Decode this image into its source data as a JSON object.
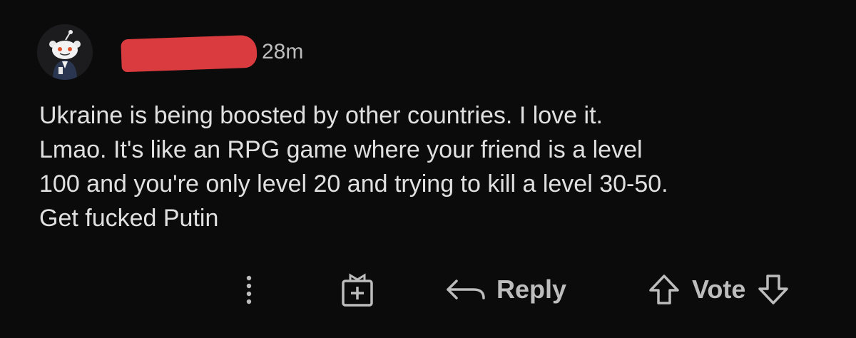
{
  "comment": {
    "avatar_icon": "snoo-avatar-icon",
    "username_redacted": true,
    "timestamp": "28m",
    "body_lines": [
      "Ukraine is being boosted by other countries. I love it.",
      "Lmao. It's like an RPG game where your friend is a level",
      "100 and you're only level 20 and trying to kill a level 30-50.",
      "Get fucked Putin"
    ]
  },
  "actions": {
    "more_icon": "more-vertical-icon",
    "award_icon": "award-gift-icon",
    "reply_icon": "reply-arrow-icon",
    "reply_label": "Reply",
    "upvote_icon": "upvote-arrow-icon",
    "vote_label": "Vote",
    "downvote_icon": "downvote-arrow-icon"
  },
  "colors": {
    "background": "#0b0b0b",
    "text": "#e0e0e0",
    "muted": "#bdbdbd",
    "redaction": "#d93b3f"
  }
}
